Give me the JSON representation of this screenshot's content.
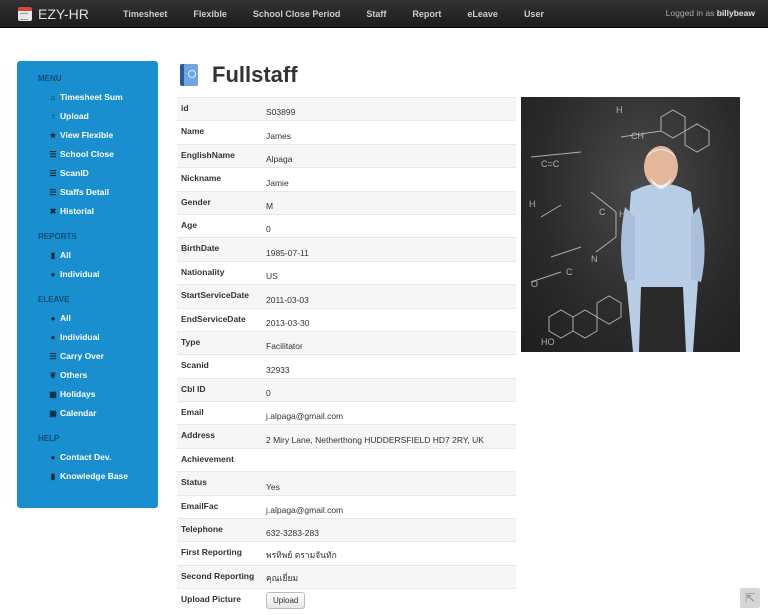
{
  "navbar": {
    "brand": "EZY-HR",
    "items": [
      "Timesheet",
      "Flexible",
      "School Close Period",
      "Staff",
      "Report",
      "eLeave",
      "User"
    ],
    "logged_in_prefix": "Logged in as",
    "username": "billybeaw"
  },
  "sidebar": {
    "sections": [
      {
        "header": "MENU",
        "items": [
          {
            "icon": "home-icon",
            "glyph": "⌂",
            "label": "Timesheet Sum"
          },
          {
            "icon": "upload-icon",
            "glyph": "↑",
            "label": "Upload"
          },
          {
            "icon": "star-icon",
            "glyph": "★",
            "label": "View Flexible"
          },
          {
            "icon": "list-icon",
            "glyph": "☰",
            "label": "School Close"
          },
          {
            "icon": "list-icon",
            "glyph": "☰",
            "label": "ScanID"
          },
          {
            "icon": "list-icon",
            "glyph": "☰",
            "label": "Staffs Detail"
          },
          {
            "icon": "tools-icon",
            "glyph": "✖",
            "label": "Historial"
          }
        ]
      },
      {
        "header": "REPORTS",
        "items": [
          {
            "icon": "bar-chart-icon",
            "glyph": "▮",
            "label": "All"
          },
          {
            "icon": "user-icon",
            "glyph": "●",
            "label": "Individual"
          }
        ]
      },
      {
        "header": "ELEAVE",
        "items": [
          {
            "icon": "user-icon",
            "glyph": "●",
            "label": "All"
          },
          {
            "icon": "user-icon",
            "glyph": "●",
            "label": "Individual"
          },
          {
            "icon": "list-icon",
            "glyph": "☰",
            "label": "Carry Over"
          },
          {
            "icon": "leaf-icon",
            "glyph": "❦",
            "label": "Others"
          },
          {
            "icon": "calendar-icon",
            "glyph": "▦",
            "label": "Holidays"
          },
          {
            "icon": "calendar-icon",
            "glyph": "▦",
            "label": "Calendar"
          }
        ]
      },
      {
        "header": "HELP",
        "items": [
          {
            "icon": "info-icon",
            "glyph": "●",
            "label": "Contact Dev."
          },
          {
            "icon": "book-icon",
            "glyph": "▮",
            "label": "Knowledge Base"
          }
        ]
      }
    ]
  },
  "page": {
    "title": "Fullstaff",
    "fields": [
      {
        "key": "id",
        "value": "S03899"
      },
      {
        "key": "Name",
        "value": "James"
      },
      {
        "key": "EnglishName",
        "value": "Alpaga"
      },
      {
        "key": "Nickname",
        "value": "Jamie"
      },
      {
        "key": "Gender",
        "value": "M"
      },
      {
        "key": "Age",
        "value": "0"
      },
      {
        "key": "BirthDate",
        "value": "1985-07-11"
      },
      {
        "key": "Nationality",
        "value": "US"
      },
      {
        "key": "StartServiceDate",
        "value": "2011-03-03"
      },
      {
        "key": "EndServiceDate",
        "value": "2013-03-30"
      },
      {
        "key": "Type",
        "value": "Facilitator"
      },
      {
        "key": "Scanid",
        "value": "32933"
      },
      {
        "key": "Cbl ID",
        "value": "0"
      },
      {
        "key": "Email",
        "value": "j.alpaga@gmail.com"
      },
      {
        "key": "Address",
        "value": "2 Miry Lane, Netherthong HUDDERSFIELD HD7 2RY, UK"
      },
      {
        "key": "Achievement",
        "value": ""
      },
      {
        "key": "Status",
        "value": "Yes"
      },
      {
        "key": "EmailFac",
        "value": "j.alpaga@gmail.com"
      },
      {
        "key": "Telephone",
        "value": "632-3283-283"
      },
      {
        "key": "First Reporting",
        "value": "พรทิพย์ ตรามจันทัก"
      },
      {
        "key": "Second Reporting",
        "value": "คุณเยี่ยม"
      }
    ],
    "upload_label": "Upload Picture",
    "upload_button": "Upload"
  }
}
